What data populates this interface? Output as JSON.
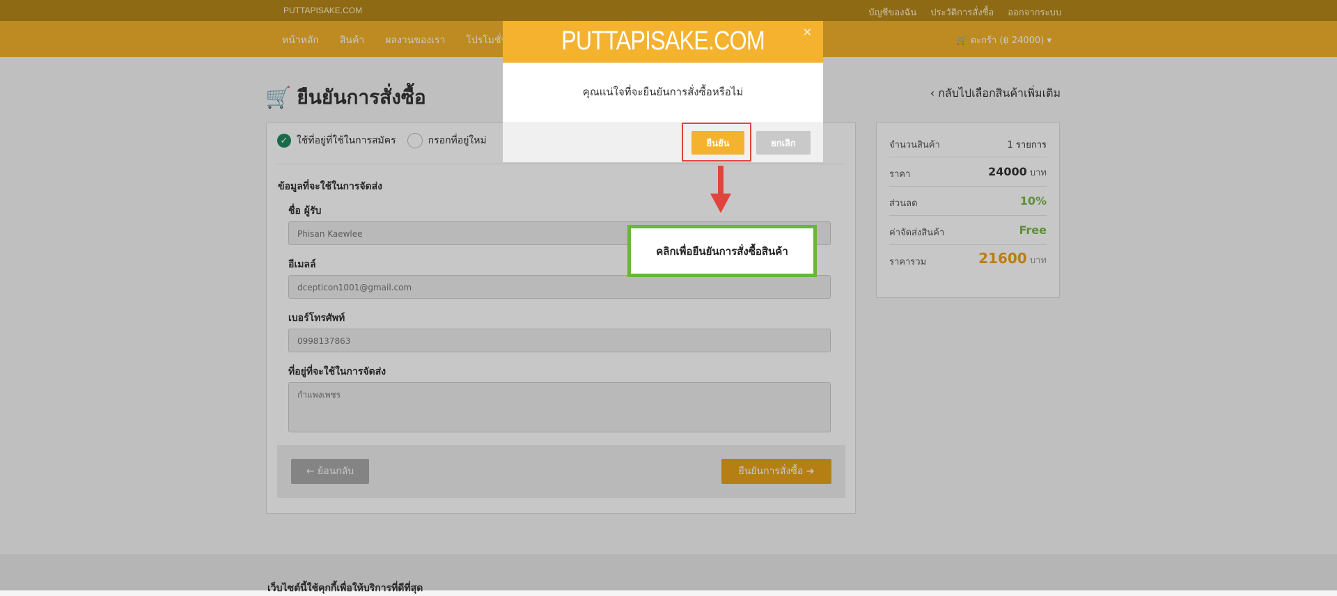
{
  "topbar": {
    "brand": "PUTTAPISAKE.COM",
    "links": [
      "บัญชีของฉัน",
      "ประวัติการสั่งซื้อ",
      "ออกจากระบบ"
    ]
  },
  "navbar": {
    "menu": [
      "หน้าหลัก",
      "สินค้า",
      "ผลงานของเรา",
      "โปรโมชั่น"
    ],
    "cart": "ตะกร้า (฿ 24000)"
  },
  "page": {
    "title": "ยืนยันการสั่งซื้อ",
    "back_link": "กลับไปเลือกสินค้าเพิ่มเติม"
  },
  "form": {
    "option_registered": "ใช้ที่อยู่ที่ใช้ในการสมัคร",
    "option_new": "กรอกที่อยู่ใหม่",
    "section_label": "ข้อมูลที่จะใช้ในการจัดส่ง",
    "name_label": "ชื่อ ผู้รับ",
    "name_value": "Phisan Kaewlee",
    "email_label": "อีเมลล์",
    "email_value": "dcepticon1001@gmail.com",
    "phone_label": "เบอร์โทรศัพท์",
    "phone_value": "0998137863",
    "address_label": "ที่อยู่ที่จะใช้ในการจัดส่ง",
    "address_value": "กำแพงเพชร",
    "back_button": "ย้อนกลับ",
    "confirm_button": "ยืนยันการสั่งซื้อ"
  },
  "summary": {
    "items_label": "จำนวนสินค้า",
    "items_value": "1 รายการ",
    "price_label": "ราคา",
    "price_value": "24000",
    "price_unit": "บาท",
    "discount_label": "ส่วนลด",
    "discount_value": "10%",
    "shipping_label": "ค่าจัดส่งสินค้า",
    "shipping_value": "Free",
    "total_label": "ราคารวม",
    "total_value": "21600",
    "total_unit": "บาท"
  },
  "footer": {
    "text": "เว็บไซต์นี้ใช้คุกกี้เพื่อให้บริการที่ดีที่สุด"
  },
  "modal": {
    "title": "PUTTAPISAKE.COM",
    "close": "×",
    "message": "คุณแน่ใจที่จะยืนยันการสั่งซื้อหรือไม่",
    "yes": "ยืนยัน",
    "no": "ยกเลิก"
  },
  "callout": {
    "text": "คลิกเพื่อยืนยันการสั่งซื้อสินค้า"
  },
  "colors": {
    "brand_yellow": "#f4b22e",
    "topbar": "#b8881a",
    "success_green": "#1f8a5d",
    "discount_green": "#7ab648",
    "total_orange": "#f0a01b",
    "annotation_red": "#e0443c",
    "callout_green": "#6bb63a"
  }
}
